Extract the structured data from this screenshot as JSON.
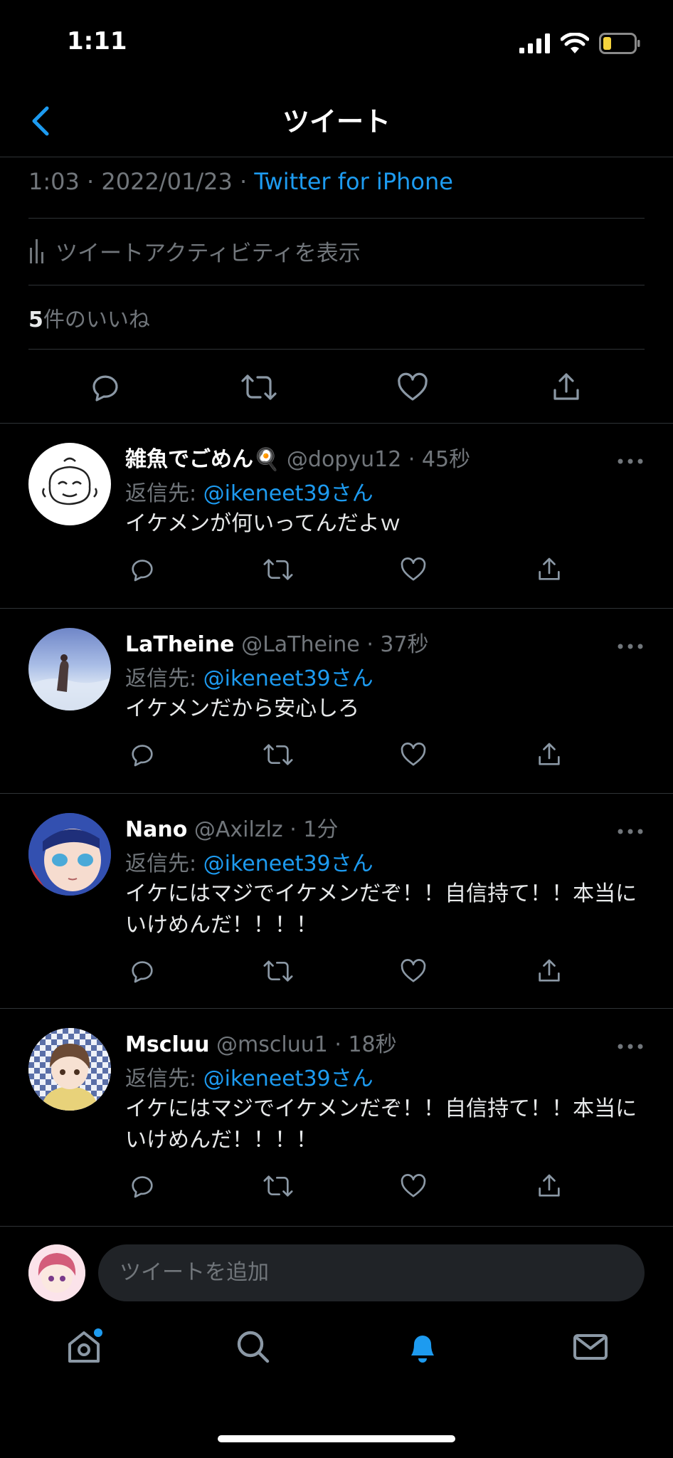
{
  "status_bar": {
    "time": "1:11"
  },
  "header": {
    "title": "ツイート"
  },
  "tweet_meta": {
    "time": "1:03",
    "sep1": " · ",
    "date": "2022/01/23",
    "sep2": " · ",
    "source": "Twitter for iPhone"
  },
  "activity": {
    "label": "ツイートアクティビティを表示"
  },
  "likes": {
    "count": "5",
    "label": "件のいいね"
  },
  "colors": {
    "accent": "#1d9bf0",
    "background": "#000000",
    "secondary_text": "#71767b",
    "divider": "#2f3336"
  },
  "replies": [
    {
      "name": "雑魚でごめん",
      "name_emoji": "🍳",
      "handle": "@dopyu12",
      "time": "· 45秒",
      "reply_prefix": "返信先: ",
      "reply_to": "@ikeneet39さん",
      "text": "イケメンが何いってんだよｗ"
    },
    {
      "name": "LaTheine",
      "handle": "@LaTheine",
      "time": "· 37秒",
      "reply_prefix": "返信先: ",
      "reply_to": "@ikeneet39さん",
      "text": "イケメンだから安心しろ"
    },
    {
      "name": "Nano",
      "handle": "@Axilzlz",
      "time": "· 1分",
      "reply_prefix": "返信先: ",
      "reply_to": "@ikeneet39さん",
      "text": "イケにはマジでイケメンだぞ！！自信持て！！本当にいけめんだ！！！！"
    },
    {
      "name": "Mscluu",
      "handle": "@mscluu1",
      "time": "· 18秒",
      "reply_prefix": "返信先: ",
      "reply_to": "@ikeneet39さん",
      "text": "イケにはマジでイケメンだぞ！！自信持て！！本当にいけめんだ！！！！"
    }
  ],
  "compose": {
    "placeholder": "ツイートを追加"
  },
  "tab_bar": {
    "items": [
      "home-icon",
      "search-icon",
      "bell-icon",
      "mail-icon"
    ]
  }
}
